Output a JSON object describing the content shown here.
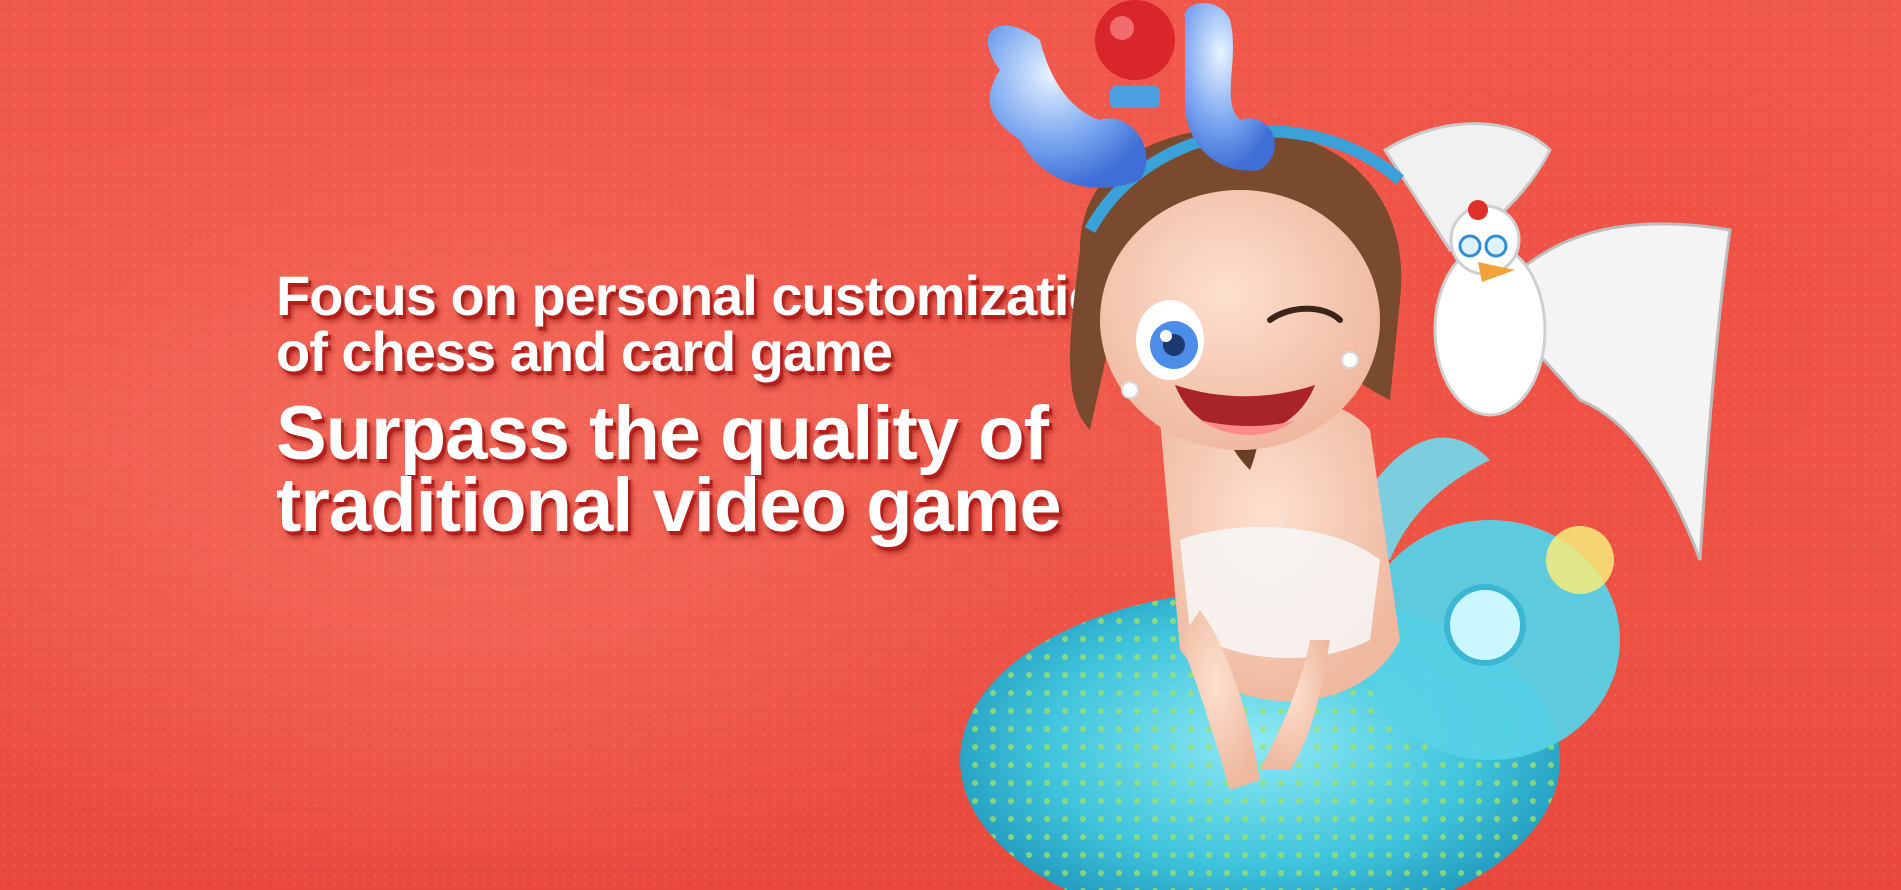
{
  "banner": {
    "tagline": {
      "line1": "Focus on personal customization",
      "line2": "of chess and card game"
    },
    "headline": {
      "line1": "Surpass the quality of",
      "line2": "traditional video game"
    },
    "illustration": "girl-with-reindeer-antlers-swim-ring-and-seagull",
    "colors": {
      "background": "#ef5a4b",
      "text": "#ffffff",
      "text_shadow": "#b3201c"
    }
  }
}
